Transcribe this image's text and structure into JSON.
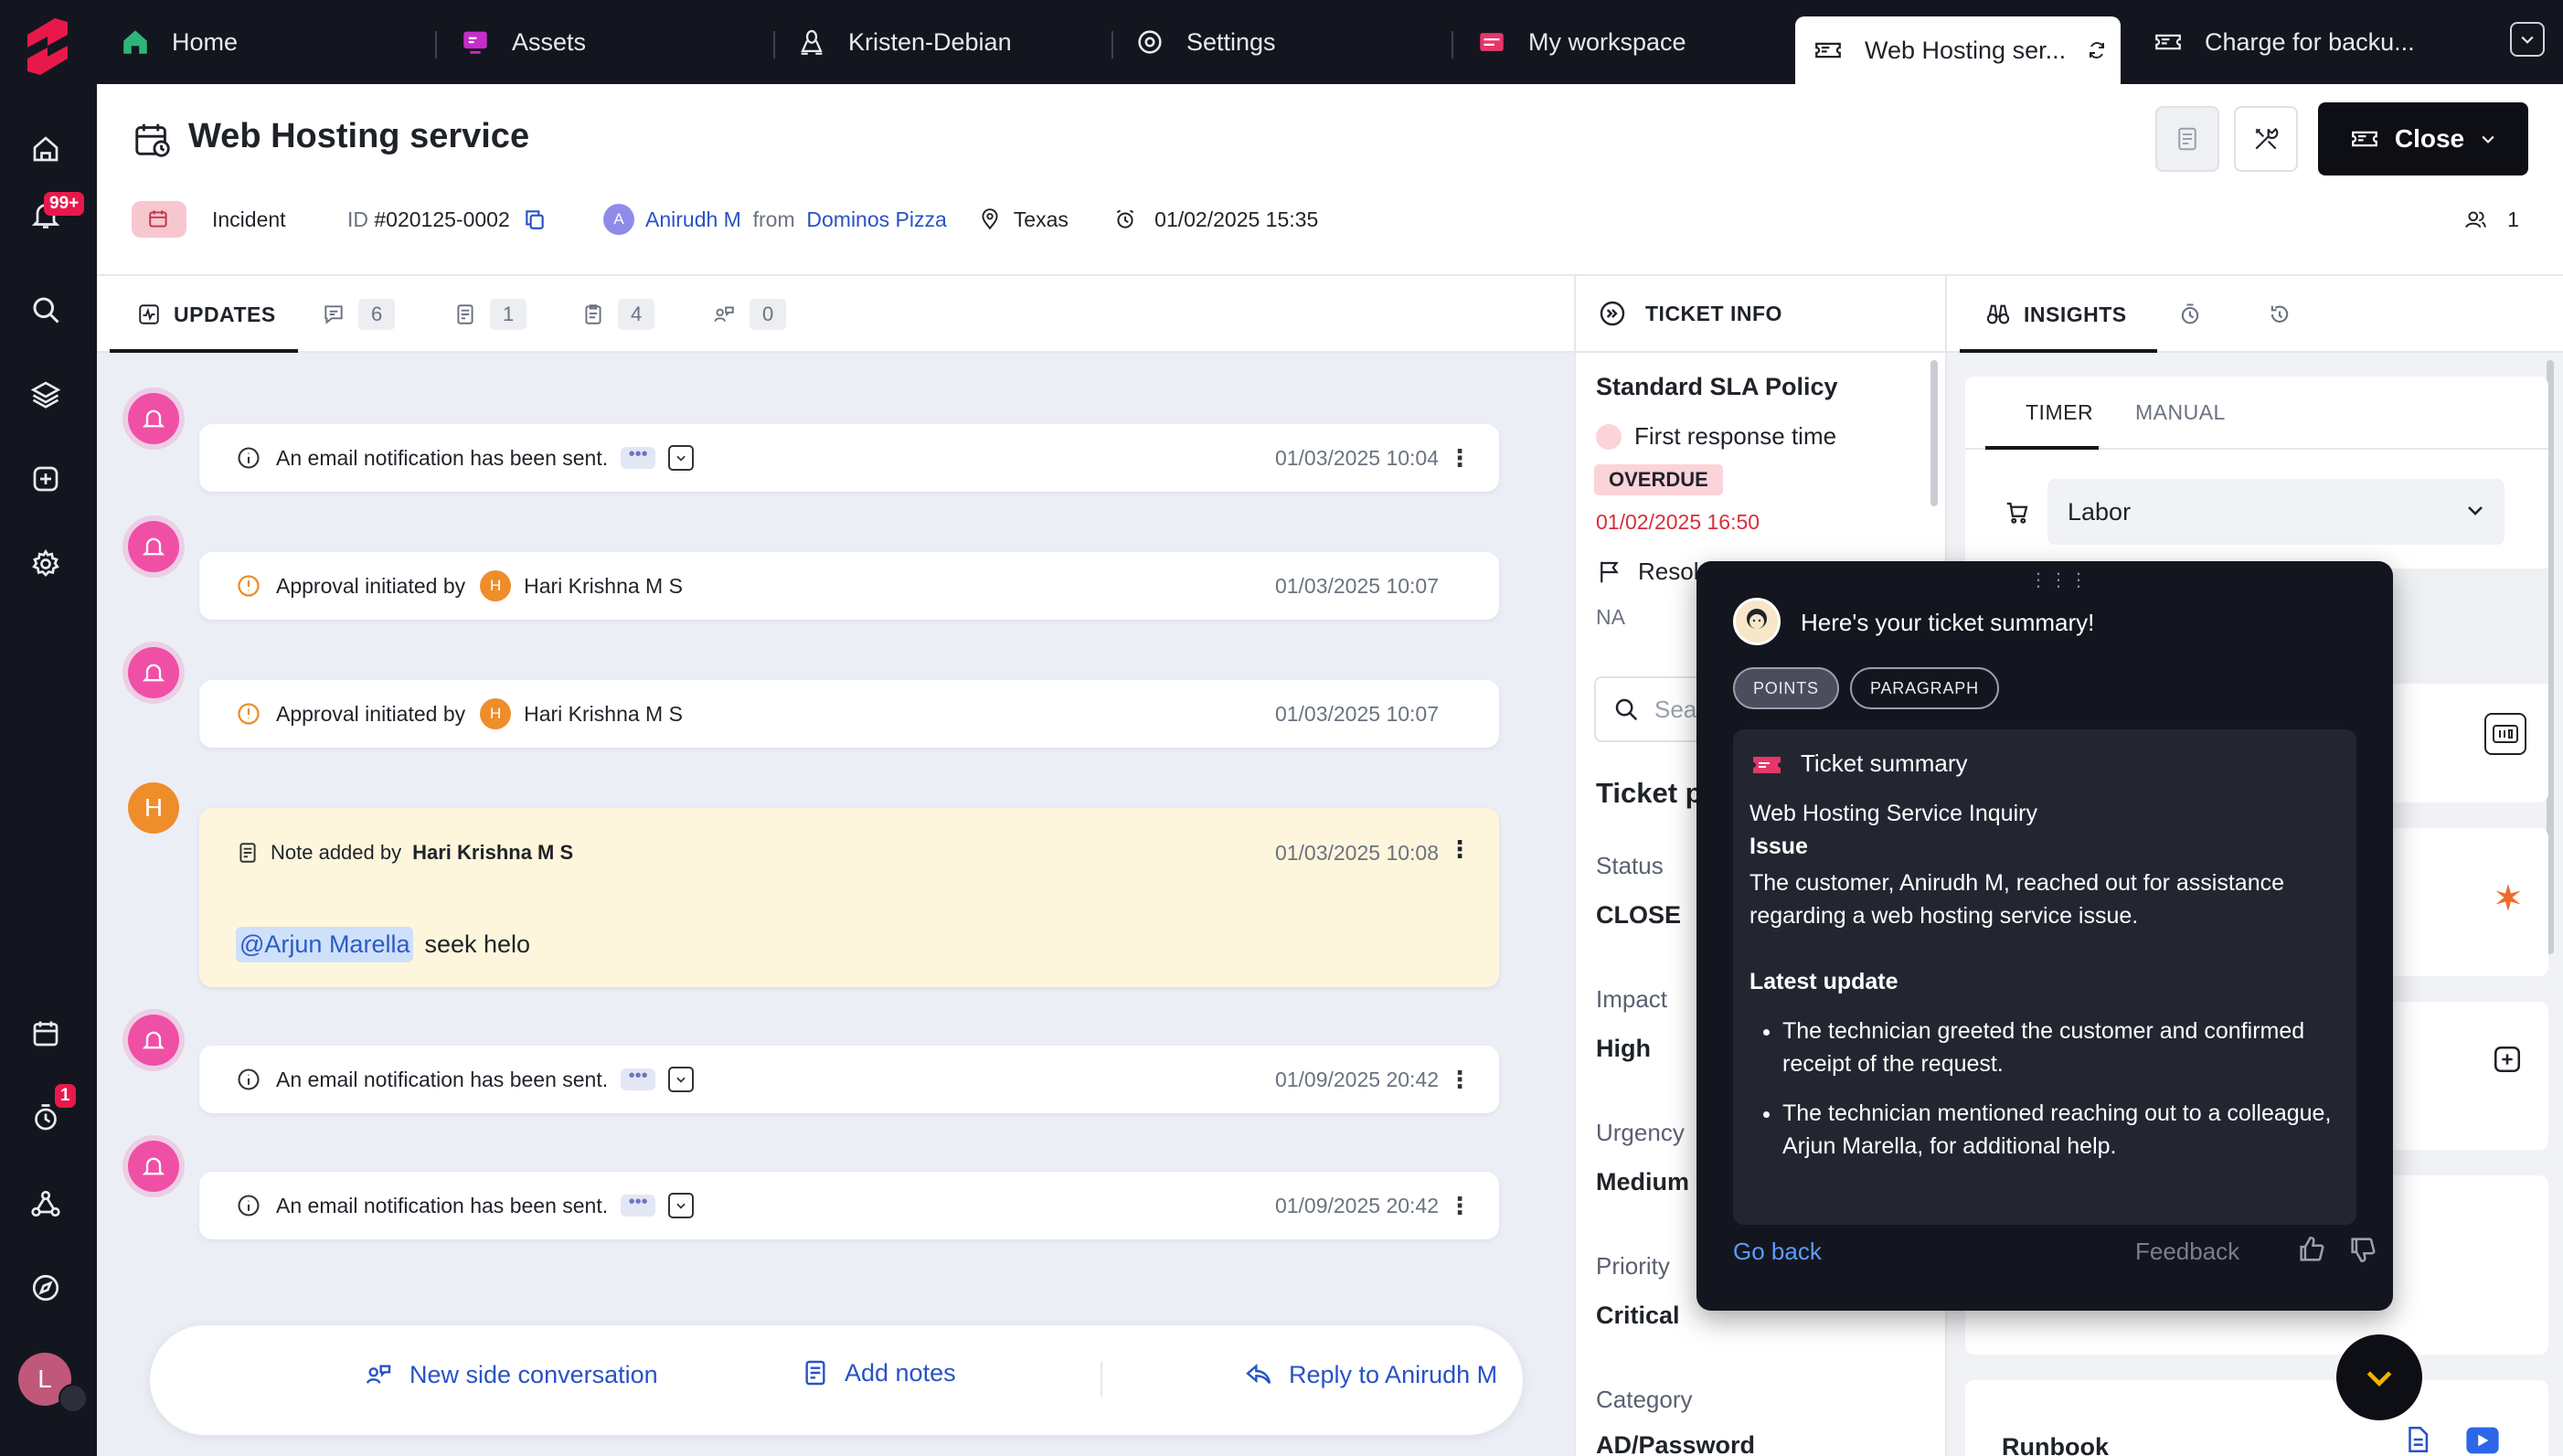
{
  "rail": {
    "notifications_badge": "99+",
    "timer_badge": "1",
    "user_initial": "L"
  },
  "tabs": [
    {
      "label": "Home",
      "icon": "home-icon"
    },
    {
      "label": "Assets",
      "icon": "assets-icon"
    },
    {
      "label": "Kristen-Debian",
      "icon": "linux-icon"
    },
    {
      "label": "Settings",
      "icon": "gear-icon"
    },
    {
      "label": "My workspace",
      "icon": "workspace-icon"
    },
    {
      "label": "Web Hosting ser...",
      "icon": "ticket-icon"
    },
    {
      "label": "Charge for backu...",
      "icon": "ticket-icon"
    }
  ],
  "header": {
    "title": "Web Hosting service",
    "close_label": "Close",
    "type": "Incident",
    "id_label": "ID",
    "id_value": "#020125-0002",
    "requester_initial": "A",
    "requester": "Anirudh M",
    "from_label": "from",
    "company": "Dominos Pizza",
    "location": "Texas",
    "created": "01/02/2025 15:35",
    "watchers_count": "1"
  },
  "updates": {
    "tabs": [
      {
        "label": "UPDATES"
      },
      {
        "count": "6"
      },
      {
        "count": "1"
      },
      {
        "count": "4"
      },
      {
        "count": "0"
      }
    ],
    "feed": [
      {
        "text": "An email notification has been sent.",
        "time": "01/03/2025 10:04"
      },
      {
        "text": "Approval initiated by",
        "user": "Hari Krishna M S",
        "user_initial": "H",
        "time": "01/03/2025 10:07"
      },
      {
        "text": "Approval initiated by",
        "user": "Hari Krishna M S",
        "user_initial": "H",
        "time": "01/03/2025 10:07"
      },
      {
        "text": "An email notification has been sent.",
        "time": "01/09/2025 20:42"
      },
      {
        "text": "An email notification has been sent.",
        "time": "01/09/2025 20:42"
      }
    ],
    "note": {
      "avatar_initial": "H",
      "prefix": "Note added by",
      "author": "Hari Krishna M S",
      "time": "01/03/2025 10:08",
      "mention": "@Arjun Marella",
      "body": "seek helo"
    },
    "actions": {
      "side_conversation": "New side conversation",
      "add_notes": "Add notes",
      "reply": "Reply to Anirudh M"
    }
  },
  "ticket_info": {
    "title": "TICKET INFO",
    "sla_policy": "Standard SLA Policy",
    "first_response": "First response time",
    "overdue": "OVERDUE",
    "first_response_due": "01/02/2025 16:50",
    "resolution_label": "Resol",
    "resolution_value": "NA",
    "search_placeholder": "Sea",
    "section": "Ticket p",
    "fields": [
      {
        "label": "Status",
        "value": "CLOSE"
      },
      {
        "label": "Impact",
        "value": "High"
      },
      {
        "label": "Urgency",
        "value": "Medium"
      },
      {
        "label": "Priority",
        "value": "Critical"
      },
      {
        "label": "Category",
        "value": "AD/Password"
      }
    ]
  },
  "insights": {
    "title": "INSIGHTS",
    "subtabs": [
      "TIMER",
      "MANUAL"
    ],
    "labor_select": "Labor",
    "runbook": "Runbook"
  },
  "summary_popup": {
    "header": "Here's your ticket summary!",
    "pills": [
      "POINTS",
      "PARAGRAPH"
    ],
    "box_title": "Ticket summary",
    "subject": "Web Hosting Service Inquiry",
    "issue_heading": "Issue",
    "issue_text": "The customer, Anirudh M, reached out for assistance regarding a web hosting service issue.",
    "latest_heading": "Latest update",
    "latest_points": [
      "The technician greeted the customer and confirmed receipt of the request.",
      "The technician mentioned reaching out to a colleague, Arjun Marella, for additional help."
    ],
    "go_back": "Go back",
    "feedback": "Feedback"
  },
  "colors": {
    "rail_bg": "#14161f",
    "accent_link": "#2852c6",
    "overdue_bg": "#fbd3d9",
    "overdue_text_red": "#d92d3a",
    "note_bg": "#fdf6dc",
    "popup_bg": "#14161f"
  }
}
